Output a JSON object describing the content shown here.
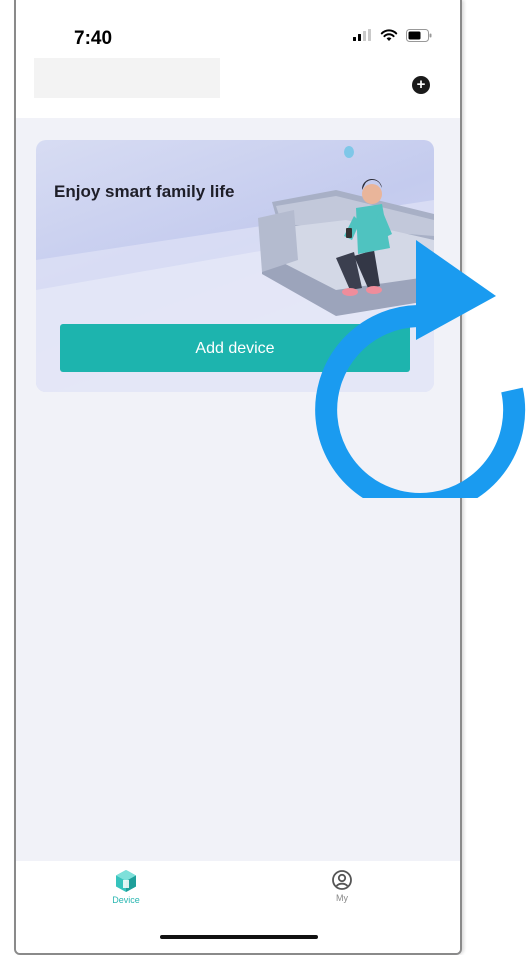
{
  "status_bar": {
    "time": "7:40"
  },
  "header": {
    "add_icon": "plus-circle-icon"
  },
  "banner": {
    "title": "Enjoy smart family life",
    "button_label": "Add device"
  },
  "tabbar": {
    "tabs": [
      {
        "label": "Device",
        "icon": "device-cube-icon",
        "active": true
      },
      {
        "label": "My",
        "icon": "user-circle-icon",
        "active": false
      }
    ]
  },
  "overlay": {
    "icon": "refresh-arrow-icon",
    "color": "#1a9bf0"
  },
  "colors": {
    "accent": "#1db4ae",
    "background": "#f1f2f8"
  }
}
